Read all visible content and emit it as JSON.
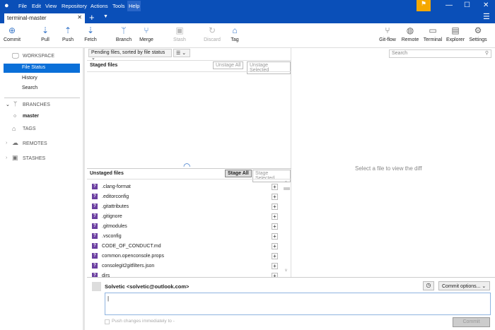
{
  "menu": [
    "File",
    "Edit",
    "View",
    "Repository",
    "Actions",
    "Tools",
    "Help"
  ],
  "tab": {
    "label": "terminal-master"
  },
  "toolbar": {
    "left": [
      "Commit",
      "Pull",
      "Push",
      "Fetch",
      "Branch",
      "Merge",
      "Stash",
      "Discard",
      "Tag"
    ],
    "right": [
      "Git-flow",
      "Remote",
      "Terminal",
      "Explorer",
      "Settings"
    ]
  },
  "sidebar": {
    "workspace": "WORKSPACE",
    "items": [
      "File Status",
      "History",
      "Search"
    ],
    "branches": "BRANCHES",
    "branch": "master",
    "tags": "TAGS",
    "remotes": "REMOTES",
    "stashes": "STASHES"
  },
  "mid": {
    "sort": "Pending files, sorted by file status",
    "staged": "Staged files",
    "unstage_all": "Unstage All",
    "unstage_selected": "Unstage Selected",
    "unstaged": "Unstaged files",
    "stage_all": "Stage All",
    "stage_selected": "Stage Selected",
    "files": [
      ".clang-format",
      ".editorconfig",
      ".gitattributes",
      ".gitignore",
      ".gitmodules",
      ".vsconfig",
      "CODE_OF_CONDUCT.md",
      "common.openconsole.props",
      "consolegit2gitfilters.json",
      "dirs"
    ]
  },
  "search": {
    "placeholder": "Search"
  },
  "diff": {
    "empty": "Select a file to view the diff"
  },
  "commit": {
    "author": "Solvetic <solvetic@outlook.com>",
    "options": "Commit options...",
    "push": "Push changes immediately to -",
    "button": "Commit"
  }
}
